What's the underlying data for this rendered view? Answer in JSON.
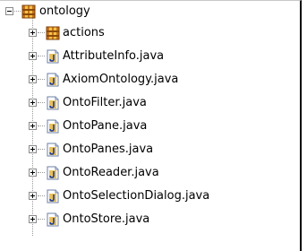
{
  "tree": {
    "root": {
      "label": "ontology",
      "icon": "package-icon",
      "expanded": true
    },
    "children": [
      {
        "label": "actions",
        "icon": "package-icon",
        "expanded": false
      },
      {
        "label": "AttributeInfo.java",
        "icon": "java-file-icon",
        "expanded": false
      },
      {
        "label": "AxiomOntology.java",
        "icon": "java-file-icon",
        "expanded": false
      },
      {
        "label": "OntoFilter.java",
        "icon": "java-file-icon",
        "expanded": false
      },
      {
        "label": "OntoPane.java",
        "icon": "java-file-icon",
        "expanded": false
      },
      {
        "label": "OntoPanes.java",
        "icon": "java-file-icon",
        "expanded": false
      },
      {
        "label": "OntoReader.java",
        "icon": "java-file-icon",
        "expanded": false
      },
      {
        "label": "OntoSelectionDialog.java",
        "icon": "java-file-icon",
        "expanded": false
      },
      {
        "label": "OntoStore.java",
        "icon": "java-file-icon",
        "expanded": false
      }
    ]
  }
}
